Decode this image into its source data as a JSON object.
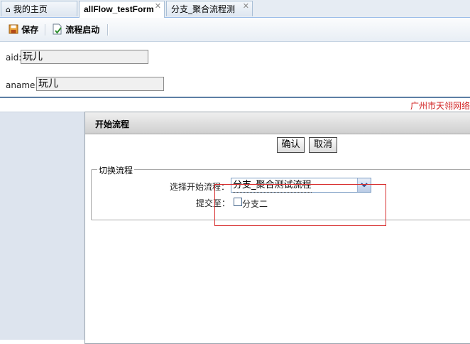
{
  "tabs": [
    {
      "label": "我的主页",
      "icon": "home-icon",
      "active": false,
      "closable": false
    },
    {
      "label": "allFlow_testForm",
      "icon": "",
      "active": true,
      "closable": true
    },
    {
      "label": "分支_聚合流程测",
      "icon": "",
      "active": false,
      "closable": true
    }
  ],
  "tab_close_glyph": "✕",
  "toolbar": {
    "save_label": "保存",
    "start_flow_label": "流程启动"
  },
  "form": {
    "aid_label": "aid:",
    "aid_value": "玩儿",
    "aname_label": "aname:",
    "aname_value": "玩儿"
  },
  "banner": {
    "text": "广州市天翎网络"
  },
  "dialog": {
    "title": "开始流程",
    "confirm_label": "确认",
    "cancel_label": "取消",
    "group_legend": "切换流程",
    "select_label": "选择开始流程：",
    "select_value": "分支_聚合测试流程",
    "submit_to_label": "提交至：",
    "submit_option_label": "分支二",
    "submit_option_checked": false
  },
  "colors": {
    "banner_text": "#d02020",
    "highlight_box": "#d83030",
    "divider": "#5d7fa5",
    "lower_bg": "#dde4ee"
  }
}
